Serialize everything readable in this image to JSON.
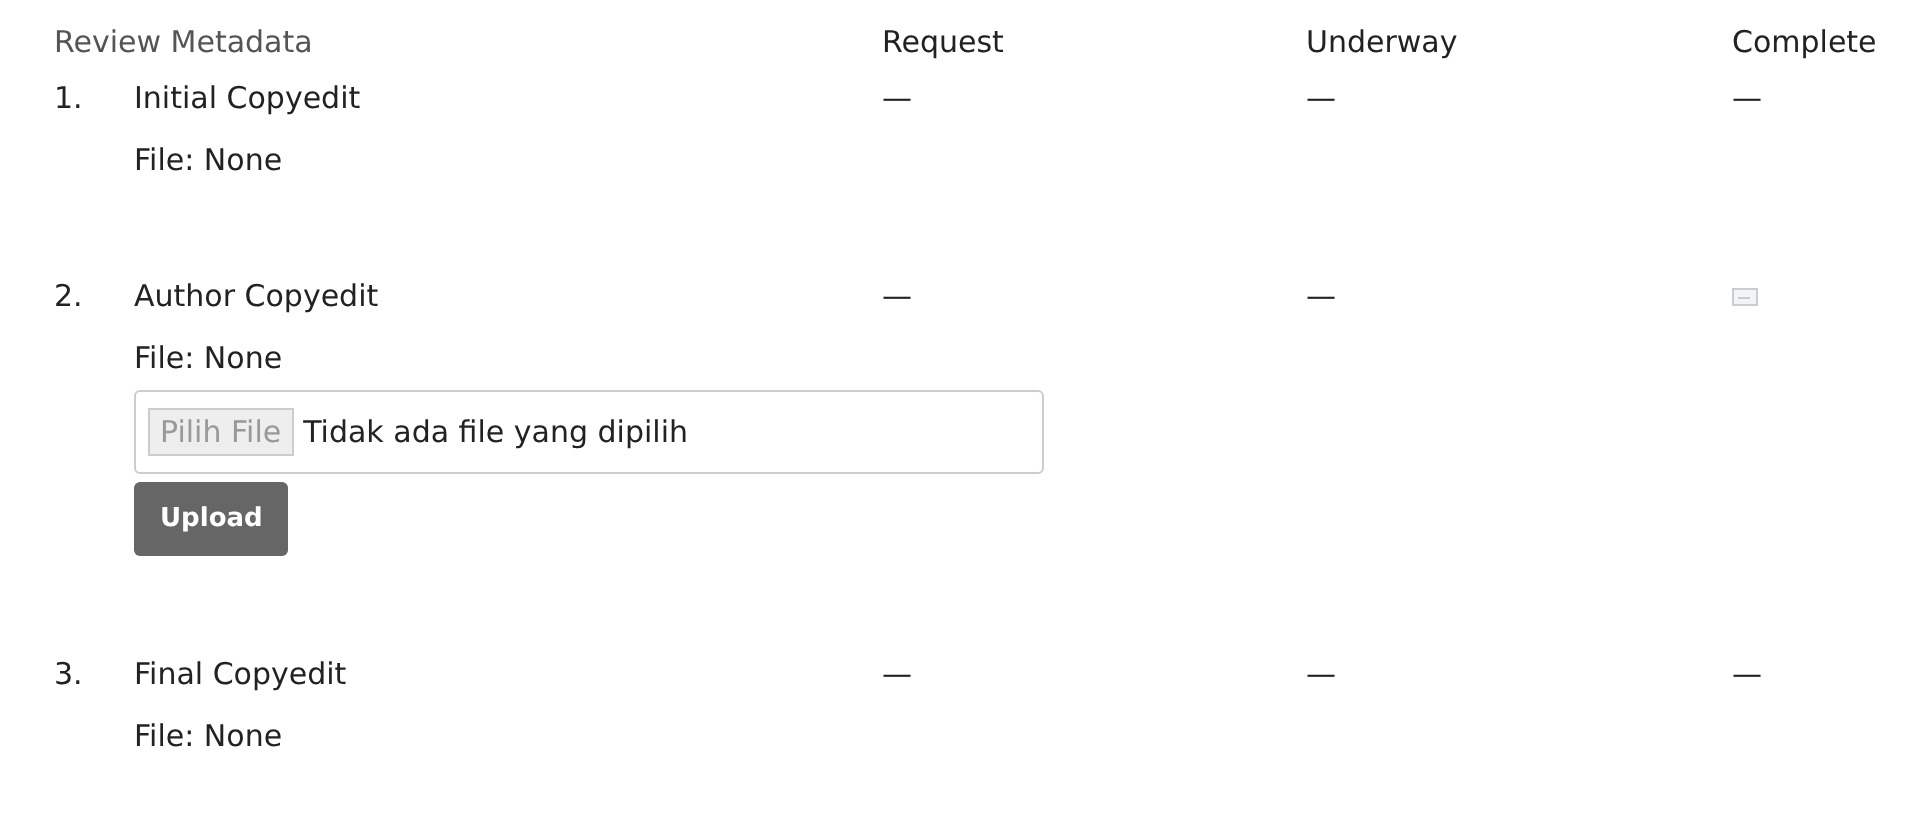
{
  "header": {
    "title": "Review Metadata",
    "columns": [
      "Request",
      "Underway",
      "Complete"
    ]
  },
  "steps": [
    {
      "number": "1.",
      "name": "Initial Copyedit",
      "file": "File: None",
      "cells": [
        {
          "kind": "dash",
          "text": "—"
        },
        {
          "kind": "dash",
          "text": "—"
        },
        {
          "kind": "dash",
          "text": "—"
        }
      ]
    },
    {
      "number": "2.",
      "name": "Author Copyedit",
      "file": "File: None",
      "upload": {
        "choose": "Pilih File",
        "status": "Tidak ada file yang dipilih",
        "button": "Upload"
      },
      "cells": [
        {
          "kind": "dash",
          "text": "—"
        },
        {
          "kind": "dash",
          "text": "—"
        },
        {
          "kind": "icon"
        }
      ]
    },
    {
      "number": "3.",
      "name": "Final Copyedit",
      "file": "File: None",
      "cells": [
        {
          "kind": "dash",
          "text": "—"
        },
        {
          "kind": "dash",
          "text": "—"
        },
        {
          "kind": "dash",
          "text": "—"
        }
      ]
    }
  ]
}
